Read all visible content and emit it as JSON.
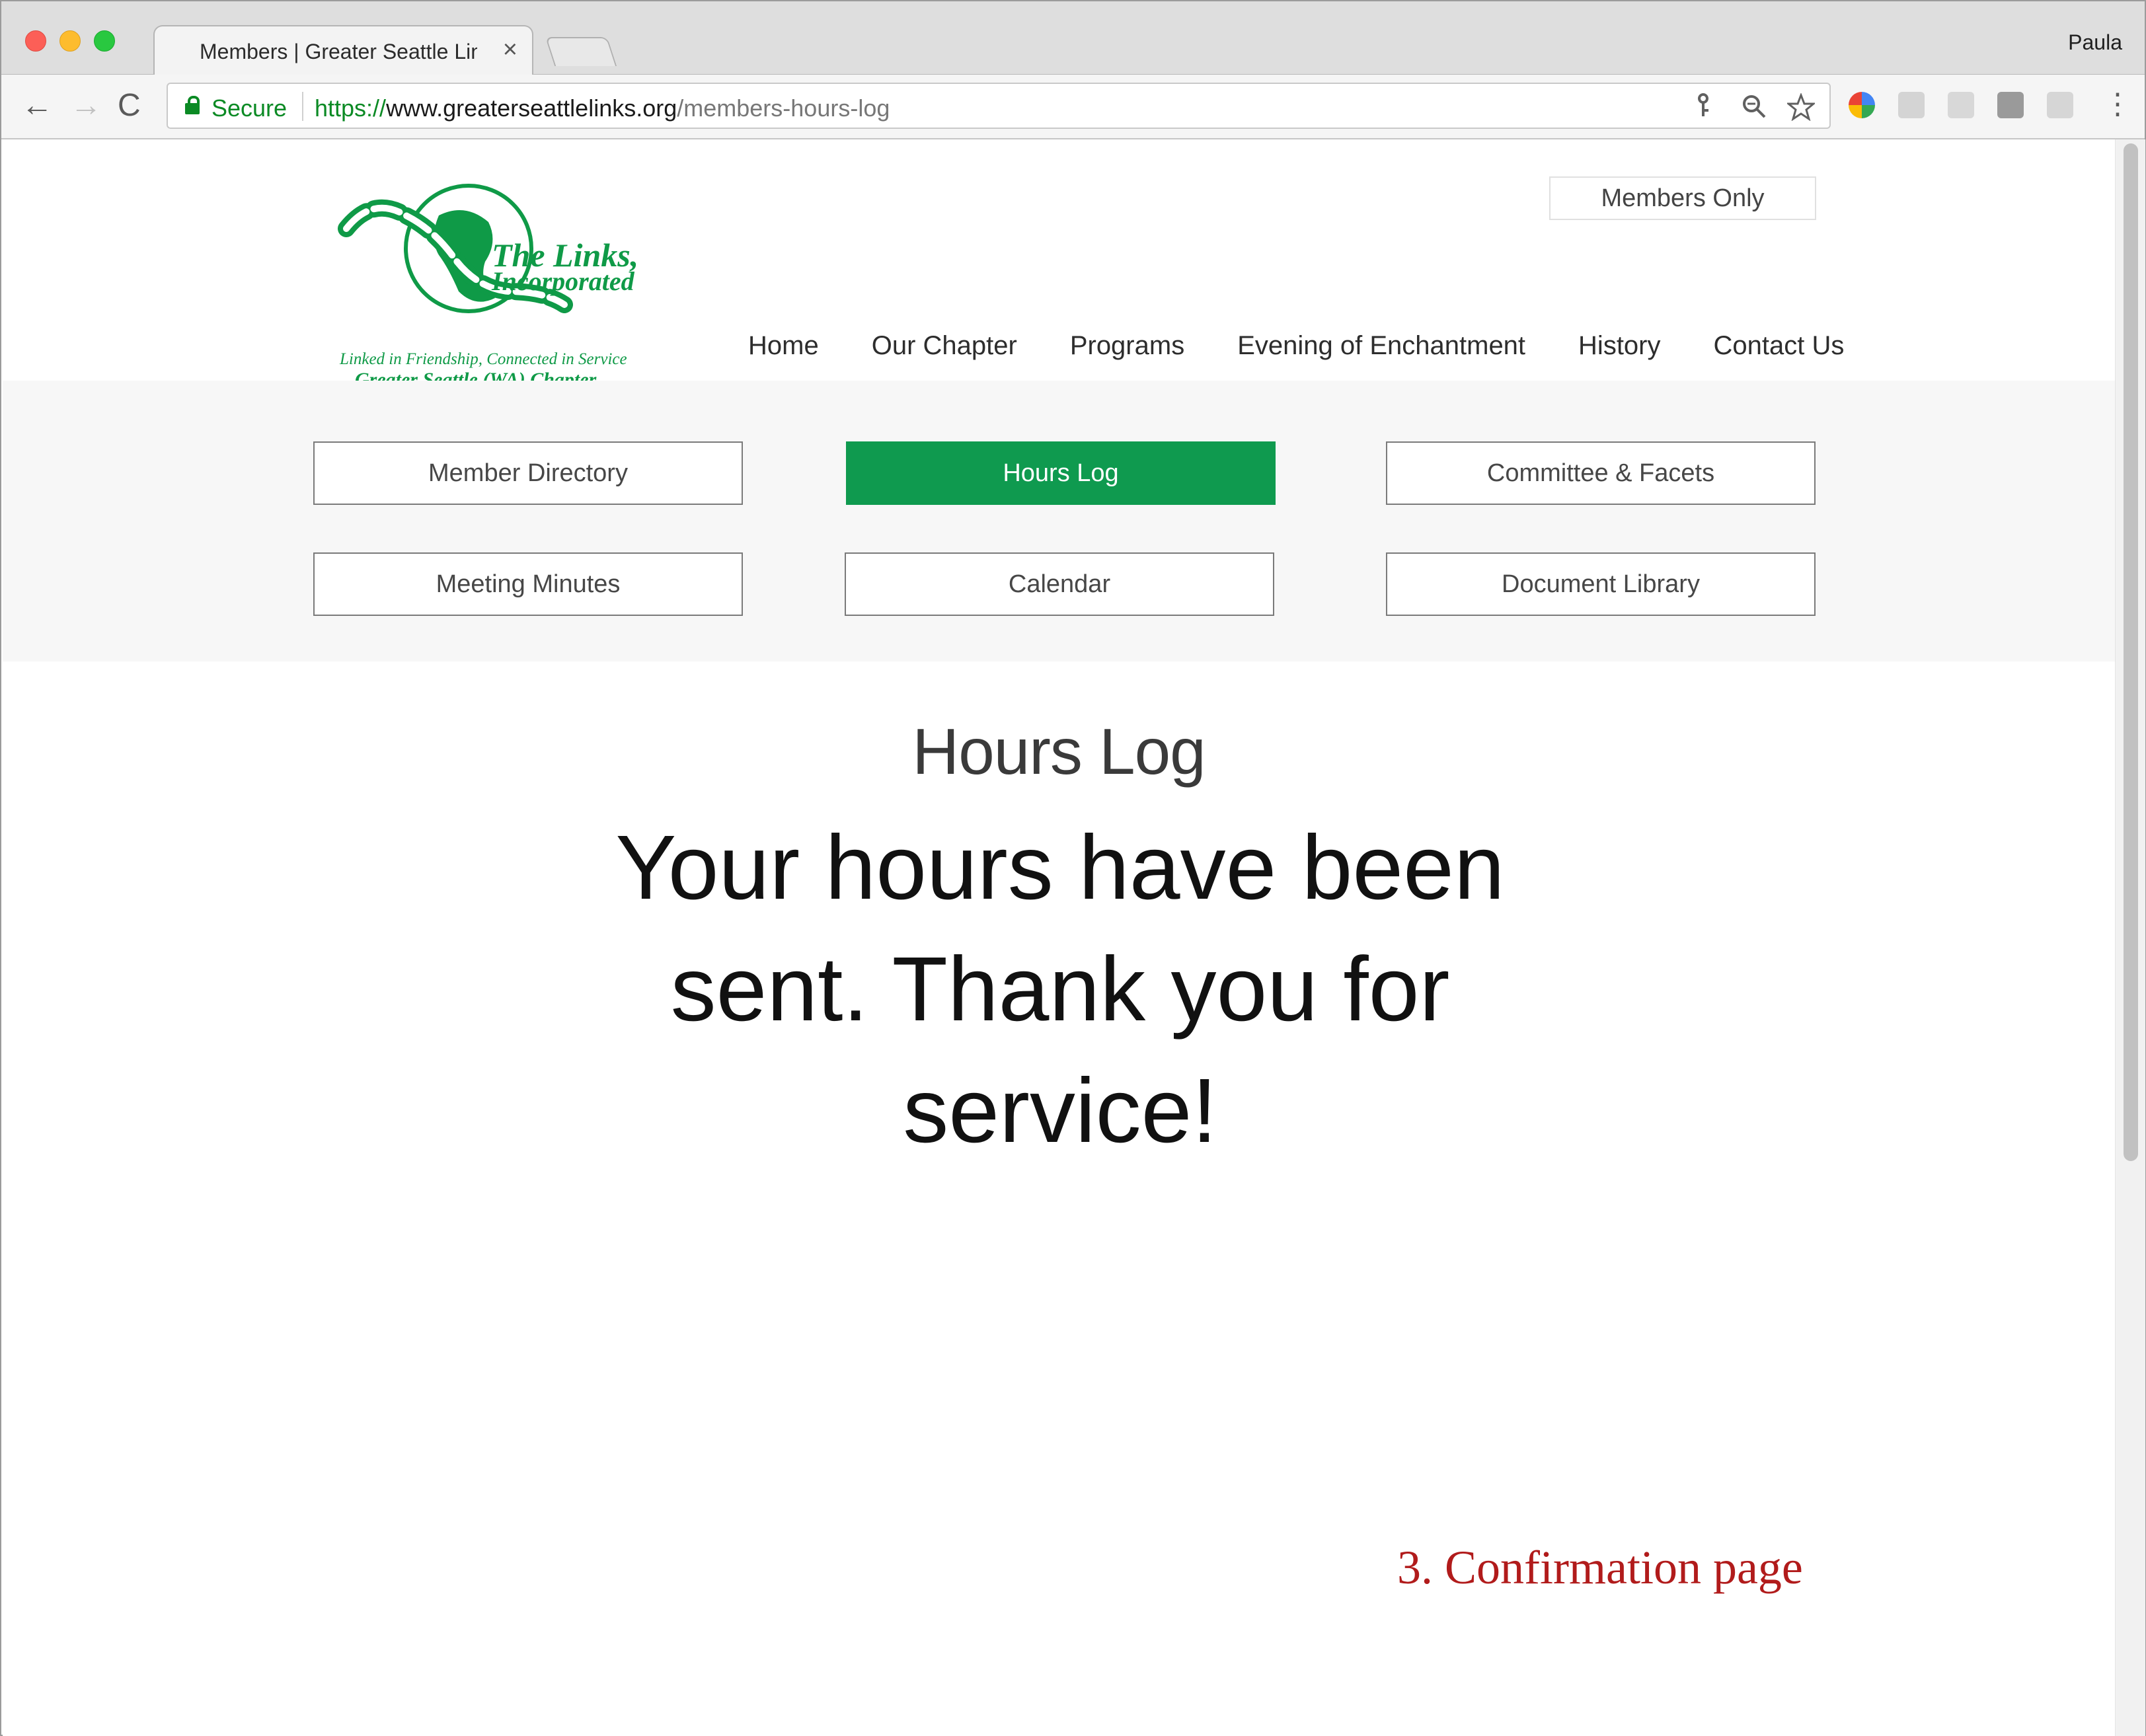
{
  "browser": {
    "tab_title": "Members | Greater Seattle Links",
    "tab_close": "×",
    "profile_name": "Paula",
    "secure_label": "Secure",
    "url_scheme": "https://",
    "url_host": "www.greaterseattlelinks.org",
    "url_path": "/members-hours-log",
    "nav": {
      "back": "←",
      "forward": "→",
      "reload": "C"
    },
    "omnibox_icons": [
      "key-icon",
      "zoom-icon",
      "star-icon"
    ],
    "extension_icons": [
      "chrome-extension-icon",
      "drive-icon",
      "dropbox-icon",
      "extension-icon",
      "google-icon"
    ],
    "menu": "⋮"
  },
  "site": {
    "logo": {
      "line1": "The Links,",
      "line2": "Incorporated",
      "tagline": "Linked in Friendship, Connected in Service",
      "chapter": "Greater Seattle (WA) Chapter"
    },
    "members_only": "Members Only",
    "nav": [
      "Home",
      "Our Chapter",
      "Programs",
      "Evening of Enchantment",
      "History",
      "Contact Us"
    ],
    "member_menu": [
      {
        "label": "Member Directory",
        "active": false
      },
      {
        "label": "Hours Log",
        "active": true
      },
      {
        "label": "Committee & Facets",
        "active": false
      },
      {
        "label": "Meeting Minutes",
        "active": false
      },
      {
        "label": "Calendar",
        "active": false
      },
      {
        "label": "Document Library",
        "active": false
      }
    ],
    "colors": {
      "brand_green": "#0f9a4f",
      "annotation_red": "#b11b1b"
    }
  },
  "content": {
    "title": "Hours Log",
    "message": "Your hours have been sent. Thank you for service!"
  },
  "annotation": "3. Confirmation page"
}
